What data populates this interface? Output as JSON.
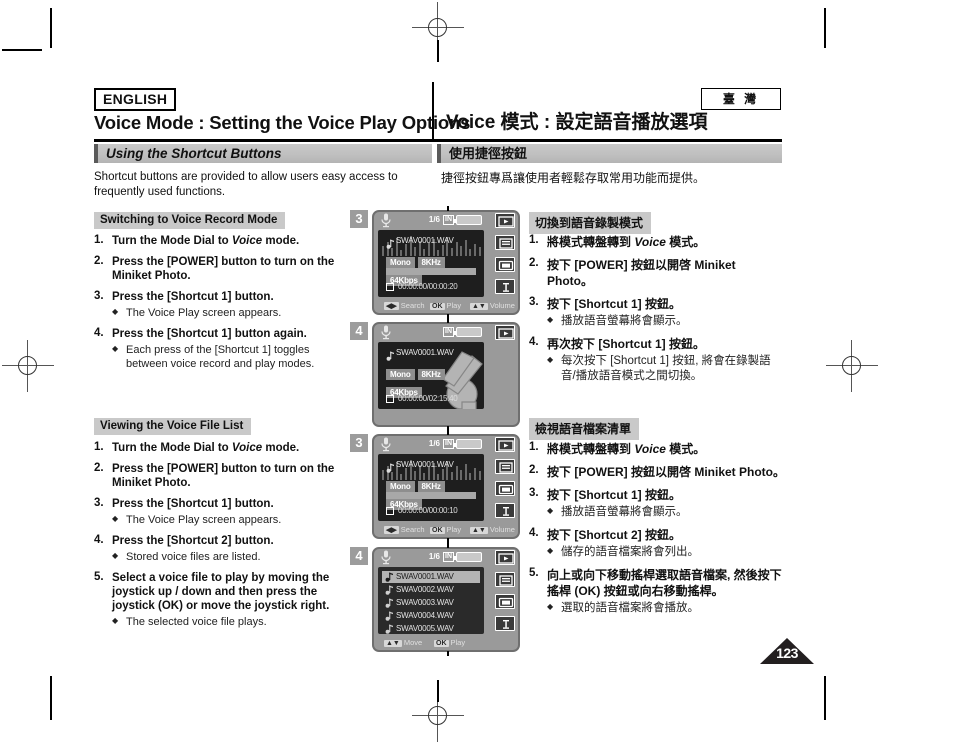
{
  "header": {
    "language_badge": "ENGLISH",
    "locale_badge": "臺 灣",
    "title_en": "Voice Mode : Setting the Voice Play Options",
    "title_zh": "Voice 模式 :  設定語音播放選項"
  },
  "section": {
    "bar_en": "Using the Shortcut Buttons",
    "bar_zh": "使用捷徑按鈕",
    "intro_en": "Shortcut buttons are provided to allow users easy access to frequently used functions.",
    "intro_zh": "捷徑按鈕專爲讓使用者輕鬆存取常用功能而提供。"
  },
  "block1": {
    "subhead_en": "Switching to Voice Record Mode",
    "subhead_zh": "切換到語音錄製模式",
    "steps_en": [
      {
        "num": "1.",
        "text": "Turn the Mode Dial to ",
        "em": "Voice",
        "text2": " mode.",
        "bullets": []
      },
      {
        "num": "2.",
        "text": "Press the [POWER] button to turn on the Miniket Photo.",
        "bullets": []
      },
      {
        "num": "3.",
        "text": "Press the [Shortcut 1] button.",
        "bullets": [
          "The Voice Play screen appears."
        ]
      },
      {
        "num": "4.",
        "text": "Press the [Shortcut 1] button again.",
        "bullets": [
          "Each press of the [Shortcut 1] toggles between voice record and play modes."
        ]
      }
    ],
    "steps_zh": [
      {
        "num": "1.",
        "text": "將模式轉盤轉到 ",
        "em": "Voice",
        "text2": " 模式。",
        "bullets": []
      },
      {
        "num": "2.",
        "text": "按下 [POWER] 按鈕以開啓 Miniket Photo。",
        "bullets": []
      },
      {
        "num": "3.",
        "text": "按下 [Shortcut 1] 按鈕。",
        "bullets": [
          "播放語音螢幕將會顯示。"
        ]
      },
      {
        "num": "4.",
        "text": "再次按下 [Shortcut 1] 按鈕。",
        "bullets": [
          "每次按下 [Shortcut 1] 按鈕, 將會在錄製語音/播放語音模式之間切換。"
        ]
      }
    ]
  },
  "block2": {
    "subhead_en": "Viewing the Voice File List",
    "subhead_zh": "檢視語音檔案清單",
    "steps_en": [
      {
        "num": "1.",
        "text": "Turn the Mode Dial to ",
        "em": "Voice",
        "text2": " mode.",
        "bullets": []
      },
      {
        "num": "2.",
        "text": "Press the [POWER] button to turn on the Miniket Photo.",
        "bullets": []
      },
      {
        "num": "3.",
        "text": "Press the [Shortcut 1] button.",
        "bullets": [
          "The Voice Play screen appears."
        ]
      },
      {
        "num": "4.",
        "text": "Press the [Shortcut 2] button.",
        "bullets": [
          "Stored voice files are listed."
        ]
      },
      {
        "num": "5.",
        "text": "Select a voice file to play by moving the joystick up / down and then press the joystick (OK) or move the joystick right.",
        "bullets": [
          "The selected voice file plays."
        ]
      }
    ],
    "steps_zh": [
      {
        "num": "1.",
        "text": "將模式轉盤轉到 ",
        "em": "Voice",
        "text2": " 模式。",
        "bullets": []
      },
      {
        "num": "2.",
        "text": "按下 [POWER] 按鈕以開啓 Miniket Photo。",
        "bullets": []
      },
      {
        "num": "3.",
        "text": "按下 [Shortcut 1] 按鈕。",
        "bullets": [
          "播放語音螢幕將會顯示。"
        ]
      },
      {
        "num": "4.",
        "text": "按下 [Shortcut 2] 按鈕。",
        "bullets": [
          "儲存的語音檔案將會列出。"
        ]
      },
      {
        "num": "5.",
        "text": "向上或向下移動搖桿選取語音檔案, 然後按下搖桿 (OK) 按鈕或向右移動搖桿。",
        "bullets": [
          "選取的語音檔案將會播放。"
        ]
      }
    ]
  },
  "lcds": [
    {
      "badge": "3",
      "type": "play",
      "page_indicator": "1/6",
      "n_mark": "IN",
      "filename": "SWAV0001.WAV",
      "chips": [
        "Mono",
        "8KHz",
        "64Kbps"
      ],
      "timecode": "00:00:00/00:00:20",
      "bottom": [
        {
          "key": "◀▶",
          "label": "Search"
        },
        {
          "key": "OK",
          "label": "Play"
        },
        {
          "key": "▲▼",
          "label": "Volume"
        }
      ],
      "side_icons": [
        "play-mode-icon",
        "file-list-icon",
        "delete-icon",
        "protect-icon"
      ]
    },
    {
      "badge": "4",
      "type": "record",
      "page_indicator": "",
      "n_mark": "IN",
      "filename": "SWAV0001.WAV",
      "chips": [
        "Mono",
        "8KHz",
        "64Kbps"
      ],
      "timecode": "00:00:00/02:15:40",
      "bottom": [],
      "side_icons": [
        "record-mode-icon"
      ]
    },
    {
      "badge": "3",
      "type": "play",
      "page_indicator": "1/6",
      "n_mark": "IN",
      "filename": "SWAV0001.WAV",
      "chips": [
        "Mono",
        "8KHz",
        "64Kbps"
      ],
      "timecode": "00:00:00/00:00:10",
      "bottom": [
        {
          "key": "◀▶",
          "label": "Search"
        },
        {
          "key": "OK",
          "label": "Play"
        },
        {
          "key": "▲▼",
          "label": "Volume"
        }
      ],
      "side_icons": [
        "play-mode-icon",
        "file-list-icon",
        "delete-icon",
        "protect-icon"
      ]
    },
    {
      "badge": "4",
      "type": "list",
      "page_indicator": "1/6",
      "n_mark": "IN",
      "files": [
        "SWAV0001.WAV",
        "SWAV0002.WAV",
        "SWAV0003.WAV",
        "SWAV0004.WAV",
        "SWAV0005.WAV"
      ],
      "selected_index": 0,
      "bottom": [
        {
          "key": "▲▼",
          "label": "Move"
        },
        {
          "key": "OK",
          "label": "Play"
        }
      ],
      "side_icons": [
        "play-mode-icon",
        "file-list-icon",
        "delete-icon",
        "protect-icon"
      ]
    }
  ],
  "footer": {
    "page_number": "123"
  }
}
